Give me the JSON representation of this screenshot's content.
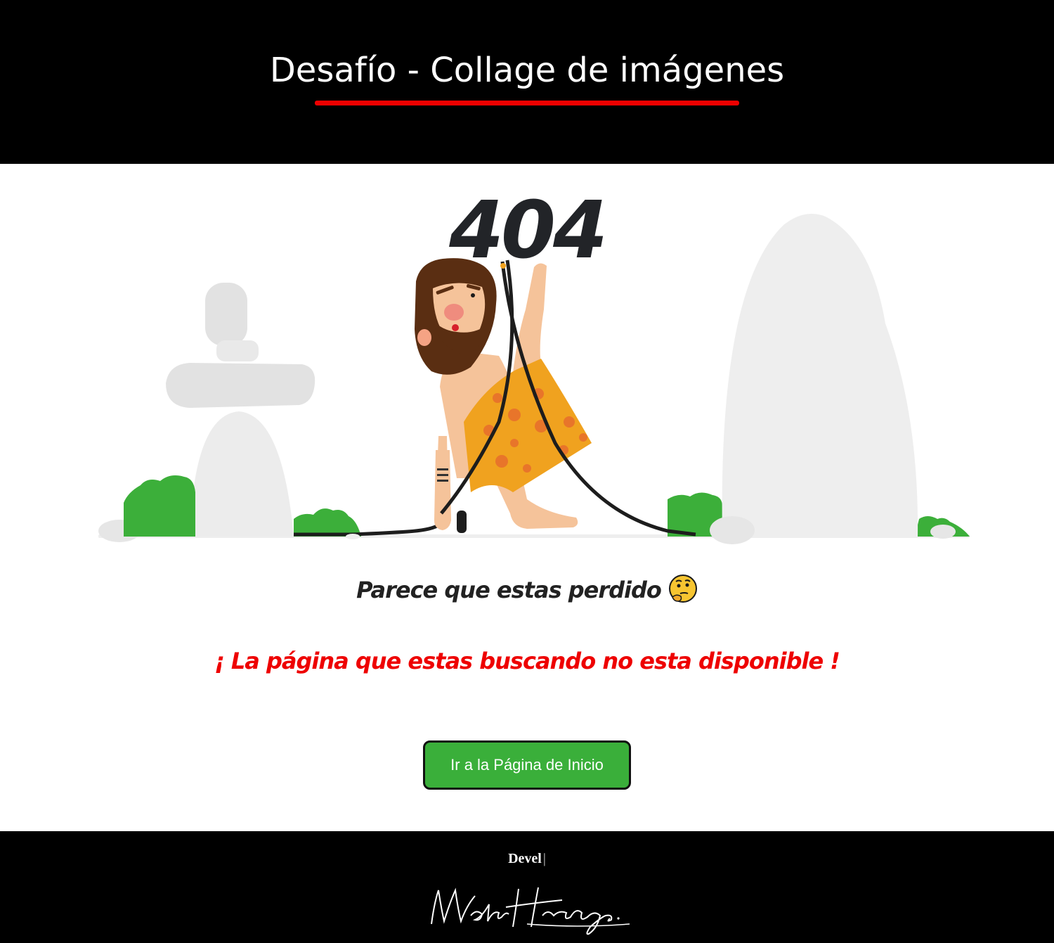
{
  "header": {
    "title": "Desafío - Collage de imágenes",
    "underline_color": "#ee0000"
  },
  "illustration": {
    "code": "404"
  },
  "message": {
    "lost": "Parece que estas perdido",
    "lost_emoji": "thinking-face-icon",
    "unavailable": "¡ La página que estas buscando no esta disponible !",
    "unavailable_color": "#ee0000"
  },
  "button": {
    "label": "Ir a la Página de Inicio",
    "color": "#3aaf3a"
  },
  "footer": {
    "devel": "Devel",
    "separator": "|",
    "signature": "Waldo Hidalgo."
  }
}
